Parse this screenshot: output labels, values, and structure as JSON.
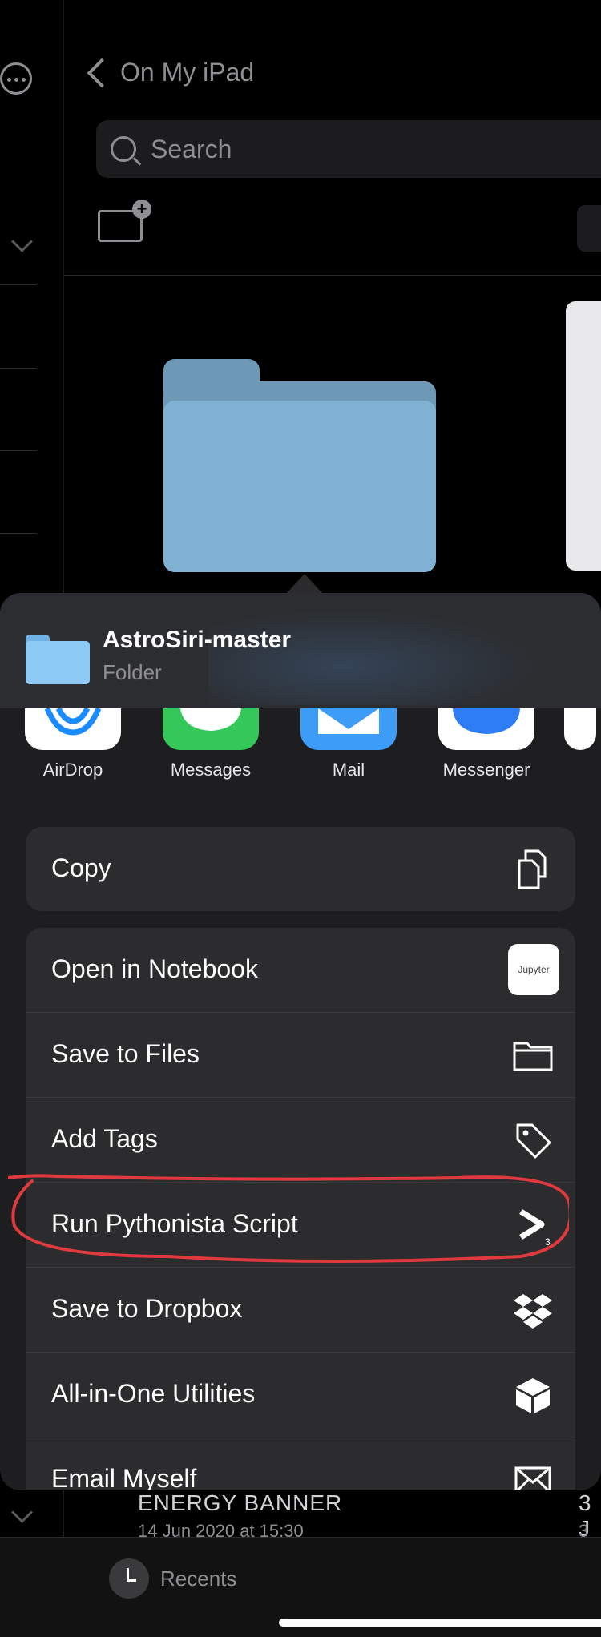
{
  "nav": {
    "back_label": "On My iPad"
  },
  "search": {
    "placeholder": "Search"
  },
  "share_sheet": {
    "title": "AstroSiri-master",
    "subtitle": "Folder",
    "apps": [
      {
        "name": "AirDrop",
        "color": "#ffffff"
      },
      {
        "name": "Messages",
        "color": "#34c759"
      },
      {
        "name": "Mail",
        "color": "#3d9cf5"
      },
      {
        "name": "Messenger",
        "color": "#ffffff"
      }
    ],
    "copy_label": "Copy",
    "actions": [
      {
        "label": "Open in Notebook",
        "icon": "jupyter-icon"
      },
      {
        "label": "Save to Files",
        "icon": "folder-icon"
      },
      {
        "label": "Add Tags",
        "icon": "tag-icon"
      },
      {
        "label": "Run Pythonista Script",
        "icon": "pythonista-icon"
      },
      {
        "label": "Save to Dropbox",
        "icon": "dropbox-icon"
      },
      {
        "label": "All-in-One Utilities",
        "icon": "cube-icon"
      },
      {
        "label": "Email Myself",
        "icon": "envelope-icon"
      }
    ],
    "jupyter_text": "Jupyter",
    "pythonista_sub": "3"
  },
  "background_list": {
    "title": "ENERGY BANNER",
    "date": "14 Jun 2020 at 15:30",
    "title2": "3 J",
    "date2": "3 J"
  },
  "tabbar": {
    "recents_label": "Recents"
  },
  "annotation_color": "#e0393e"
}
